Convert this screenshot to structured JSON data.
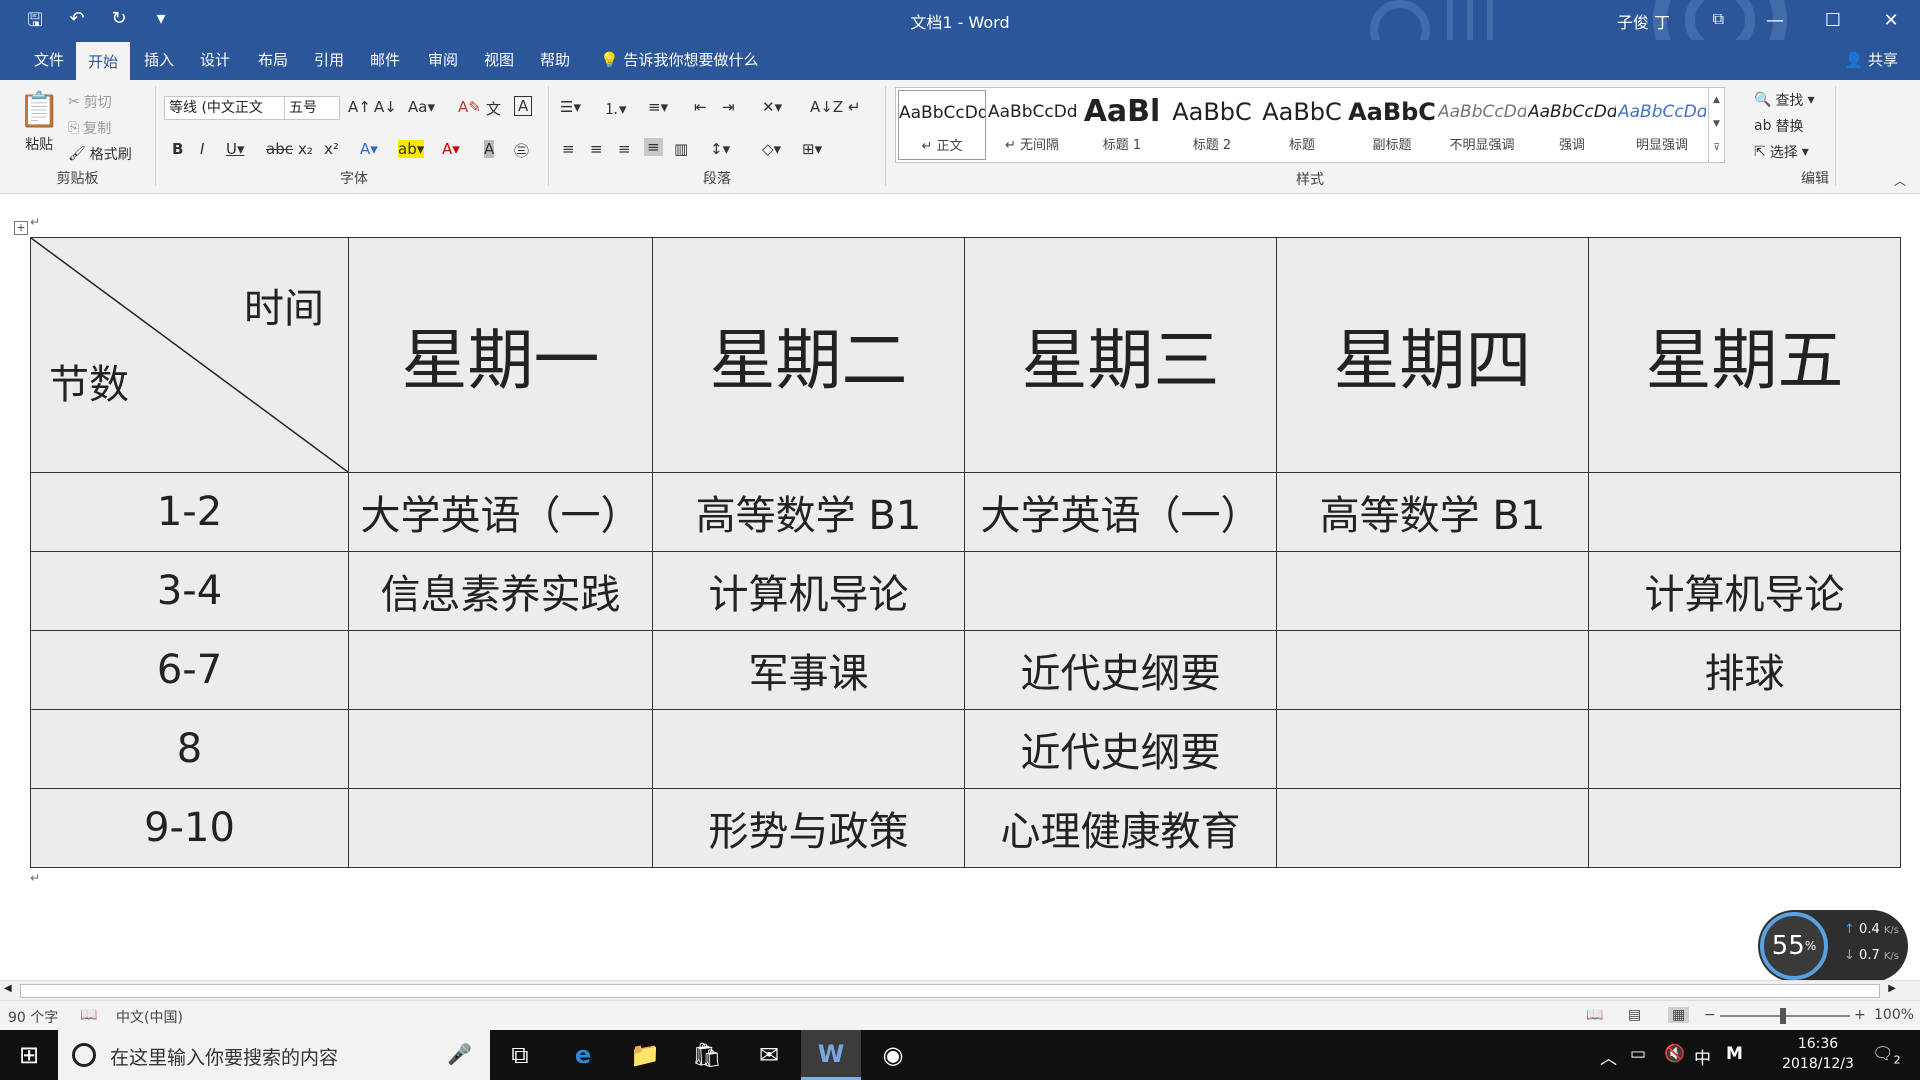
{
  "window": {
    "title": "文档1  -  Word",
    "user": "子俊 丁"
  },
  "menu": {
    "tabs": [
      "文件",
      "开始",
      "插入",
      "设计",
      "布局",
      "引用",
      "邮件",
      "审阅",
      "视图",
      "帮助"
    ],
    "active_tab": "开始",
    "tell_me": "告诉我你想要做什么",
    "share": "共享"
  },
  "ribbon": {
    "clipboard": {
      "paste": "粘贴",
      "cut": "剪切",
      "copy": "复制",
      "format_painter": "格式刷",
      "label": "剪贴板"
    },
    "font": {
      "font_name": "等线 (中文正文",
      "font_size": "五号",
      "label": "字体"
    },
    "paragraph": {
      "label": "段落"
    },
    "styles": {
      "label": "样式",
      "items": [
        {
          "sample": "AaBbCcDd",
          "name": "↵ 正文"
        },
        {
          "sample": "AaBbCcDd",
          "name": "↵ 无间隔"
        },
        {
          "sample": "AaBl",
          "name": "标题 1"
        },
        {
          "sample": "AaBbC",
          "name": "标题 2"
        },
        {
          "sample": "AaBbC",
          "name": "标题"
        },
        {
          "sample": "AaBbC",
          "name": "副标题"
        },
        {
          "sample": "AaBbCcDd",
          "name": "不明显强调"
        },
        {
          "sample": "AaBbCcDd",
          "name": "强调"
        },
        {
          "sample": "AaBbCcDd",
          "name": "明显强调"
        }
      ]
    },
    "editing": {
      "find": "查找",
      "replace": "替换",
      "select": "选择",
      "label": "编辑"
    }
  },
  "timetable": {
    "corner_top": "时间",
    "corner_bottom": "节数",
    "days": [
      "星期一",
      "星期二",
      "星期三",
      "星期四",
      "星期五"
    ],
    "rows": [
      {
        "period": "1-2",
        "cells": [
          "大学英语（一）",
          "高等数学 B1",
          "大学英语（一）",
          "高等数学 B1",
          ""
        ]
      },
      {
        "period": "3-4",
        "cells": [
          "信息素养实践",
          "计算机导论",
          "",
          "",
          "计算机导论"
        ]
      },
      {
        "period": "6-7",
        "cells": [
          "",
          "军事课",
          "近代史纲要",
          "",
          "排球"
        ]
      },
      {
        "period": "8",
        "cells": [
          "",
          "",
          "近代史纲要",
          "",
          ""
        ]
      },
      {
        "period": "9-10",
        "cells": [
          "",
          "形势与政策",
          "心理健康教育",
          "",
          ""
        ]
      }
    ]
  },
  "status": {
    "word_count": "90 个字",
    "language": "中文(中国)",
    "zoom": "100%"
  },
  "net_widget": {
    "percent": "55",
    "up": "0.4",
    "down": "0.7",
    "unit": "K/s"
  },
  "taskbar": {
    "search_placeholder": "在这里输入你要搜索的内容",
    "ime": "中",
    "time": "16:36",
    "date": "2018/12/3",
    "notifications": "2"
  }
}
